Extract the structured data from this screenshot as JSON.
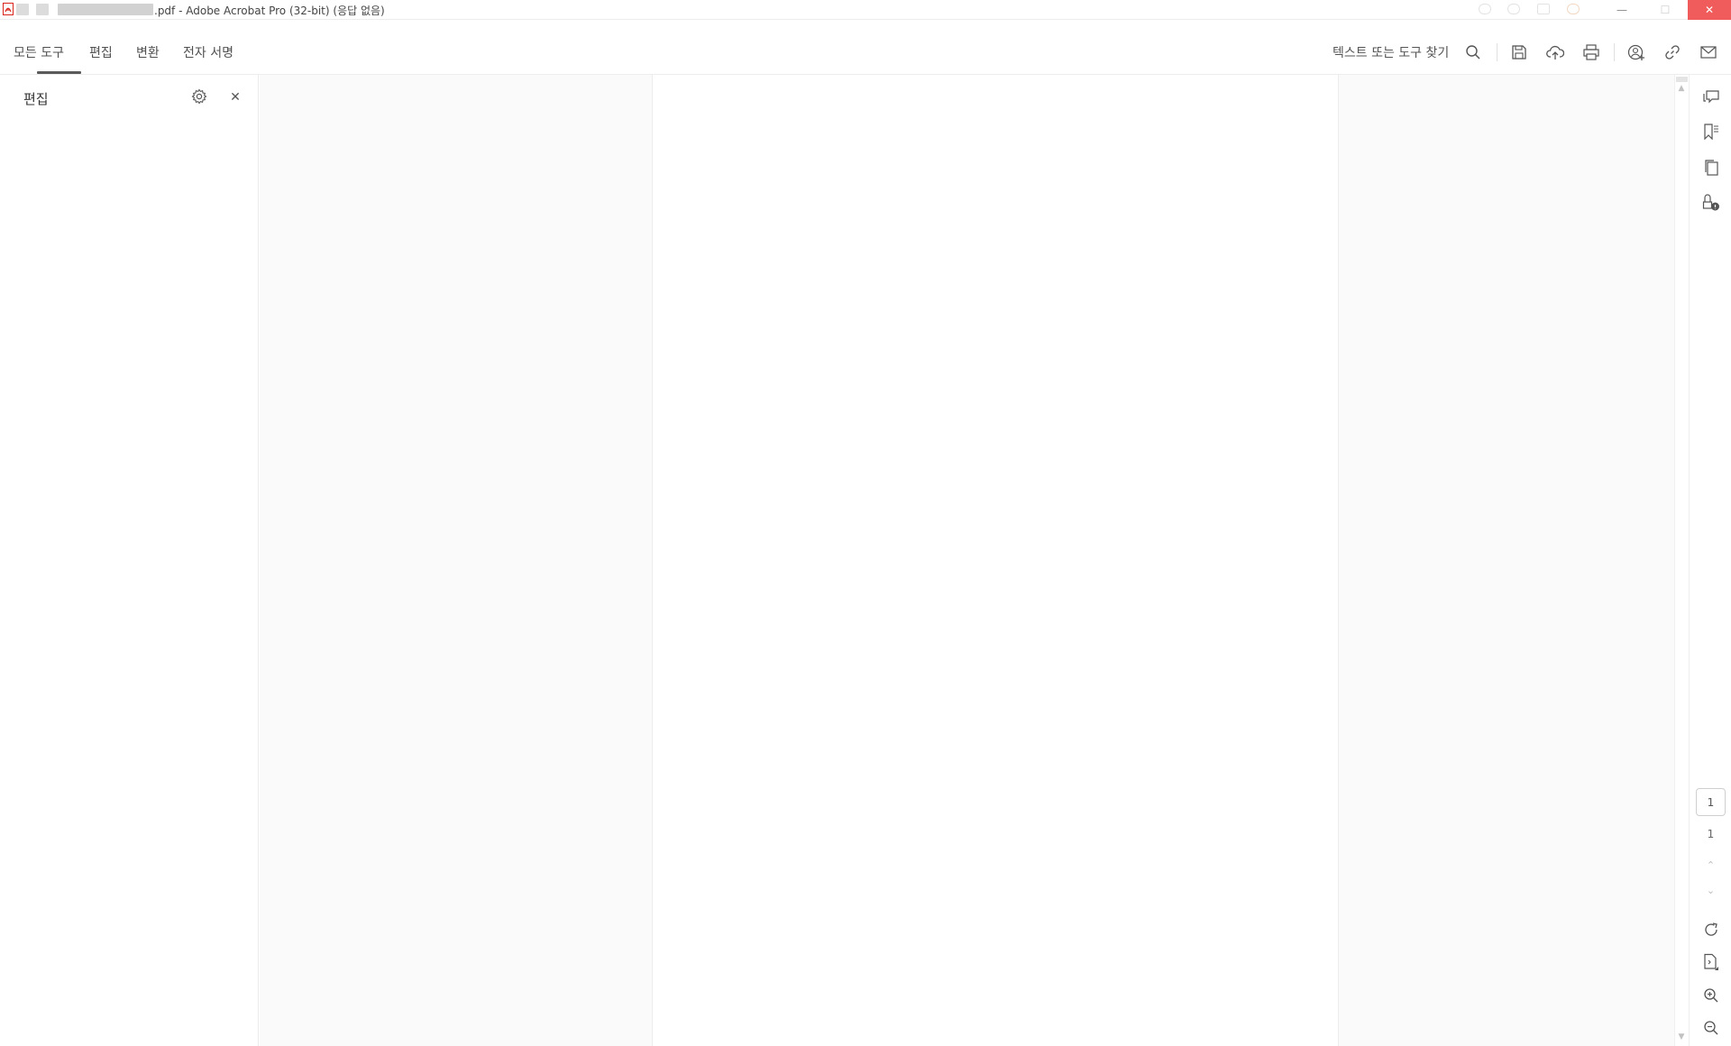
{
  "window": {
    "title": ".pdf - Adobe Acrobat Pro (32-bit) (응답 없음)",
    "controls": {
      "minimize": "—",
      "maximize": "☐",
      "close": "✕"
    }
  },
  "toolbar": {
    "tabs": [
      {
        "label": "모든 도구",
        "active": true
      },
      {
        "label": "편집",
        "active": false
      },
      {
        "label": "변환",
        "active": false
      },
      {
        "label": "전자 서명",
        "active": false
      }
    ],
    "search_label": "텍스트 또는 도구 찾기",
    "icons": [
      "search-icon",
      "save-icon",
      "upload-icon",
      "print-icon",
      "share-user-icon",
      "link-icon",
      "mail-icon"
    ]
  },
  "left_panel": {
    "title": "편집",
    "close_glyph": "✕",
    "icons": [
      "gear-icon",
      "close-icon"
    ]
  },
  "right_rail": {
    "icons": [
      "comment-icon",
      "bookmark-icon",
      "pages-icon",
      "attachment-lock-icon",
      "rotate-icon",
      "page-info-icon",
      "zoom-in-icon",
      "zoom-out-icon"
    ],
    "current_page": "1",
    "total_pages": "1",
    "up_glyph": "⌃",
    "down_glyph": "⌄"
  },
  "colors": {
    "accent": "#5a5a5a",
    "close_button": "#f05b5b",
    "acrobat_red": "#d9251c"
  }
}
